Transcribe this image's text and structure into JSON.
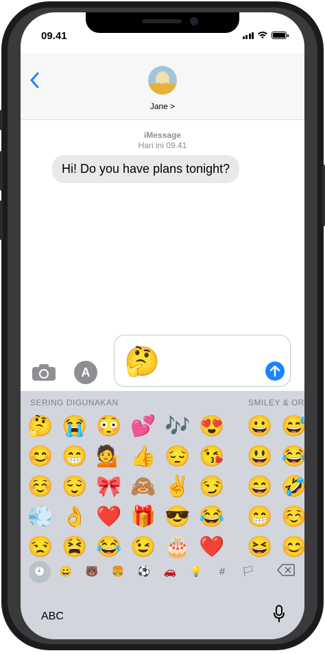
{
  "status": {
    "time": "09.41"
  },
  "header": {
    "contact_name": "Jane >",
    "back_icon": "chevron-left-icon"
  },
  "conversation": {
    "service": "iMessage",
    "timestamp": "Hari ini 09.41",
    "message": "Hi! Do you have plans tonight?"
  },
  "input": {
    "emoji": "🤔",
    "send_icon": "arrow-up-icon"
  },
  "keyboard": {
    "section_frequent": "SERING DIGUNAKAN",
    "section_smileys": "SMILEY & OR",
    "frequent_emojis": [
      "🤔",
      "😭",
      "😳",
      "💕",
      "🎶",
      "😍",
      "😊",
      "😁",
      "💁",
      "👍",
      "😔",
      "😘",
      "☺️",
      "😌",
      "🎀",
      "🙈",
      "✌️",
      "😏",
      "💨",
      "👌",
      "❤️",
      "🎁",
      "😎",
      "😂",
      "😒",
      "😫",
      "😂",
      "😉",
      "🎂",
      "❤️"
    ],
    "smiley_emojis": [
      "😀",
      "😅",
      "😃",
      "😂",
      "😄",
      "🤣",
      "😁",
      "☺️",
      "😆",
      "😊"
    ],
    "categories": [
      "🕘",
      "😀",
      "🐻",
      "🍔",
      "⚽",
      "🚗",
      "💡",
      "#",
      "🏳"
    ],
    "abc_label": "ABC",
    "delete_icon": "delete-key-icon",
    "mic_icon": "microphone-icon"
  }
}
